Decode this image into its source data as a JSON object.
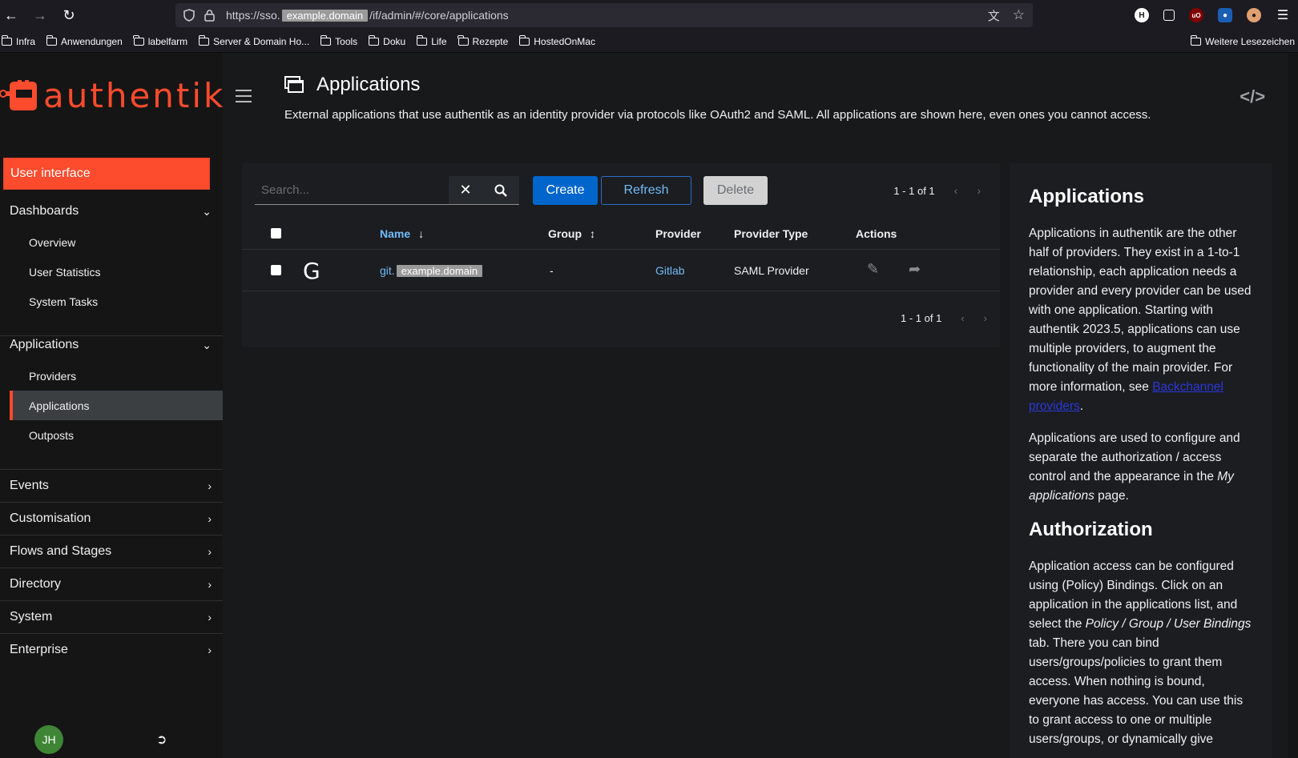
{
  "browser": {
    "url_prefix": "https://sso.",
    "url_redacted": "example.domain",
    "url_suffix": "/if/admin/#/core/applications",
    "bookmarks": [
      "Infra",
      "Anwendungen",
      "labelfarm",
      "Server & Domain Ho...",
      "Tools",
      "Doku",
      "Life",
      "Rezepte",
      "HostedOnMac"
    ],
    "bookmarks_more": "Weitere Lesezeichen"
  },
  "brand": {
    "name": "authentik",
    "color": "#fd4b2d"
  },
  "sidebar": {
    "user_interface": "User interface",
    "dashboards": {
      "label": "Dashboards",
      "items": [
        "Overview",
        "User Statistics",
        "System Tasks"
      ]
    },
    "applications": {
      "label": "Applications",
      "items": [
        "Providers",
        "Applications",
        "Outposts"
      ],
      "active": "Applications"
    },
    "collapsed": [
      "Events",
      "Customisation",
      "Flows and Stages",
      "Directory",
      "System",
      "Enterprise"
    ],
    "avatar": "JH"
  },
  "page": {
    "title": "Applications",
    "description": "External applications that use authentik as an identity provider via protocols like OAuth2 and SAML. All applications are shown here, even ones you cannot access."
  },
  "toolbar": {
    "search_placeholder": "Search...",
    "create": "Create",
    "refresh": "Refresh",
    "delete": "Delete",
    "pagination": "1 - 1 of 1"
  },
  "table": {
    "columns": {
      "name": "Name",
      "group": "Group",
      "provider": "Provider",
      "provider_type": "Provider Type",
      "actions": "Actions"
    },
    "rows": [
      {
        "icon_letter": "G",
        "name_prefix": "git.",
        "name_redacted": "example.domain",
        "group": "-",
        "provider": "Gitlab",
        "provider_type": "SAML Provider"
      }
    ]
  },
  "help": {
    "title": "Applications",
    "p1_a": "Applications in authentik are the other half of providers. They exist in a 1-to-1 relationship, each application needs a provider and every provider can be used with one application. Starting with authentik 2023.5, applications can use multiple providers, to augment the functionality of the main provider. For more information, see ",
    "p1_link": "Backchannel providers",
    "p1_b": ".",
    "p2_a": "Applications are used to configure and separate the authorization / access control and the appearance in the ",
    "p2_em": "My applications",
    "p2_b": " page.",
    "title2": "Authorization",
    "p3_a": "Application access can be configured using (Policy) Bindings. Click on an application in the applications list, and select the ",
    "p3_em": "Policy / Group / User Bindings",
    "p3_b": " tab. There you can bind users/groups/policies to grant them access. When nothing is bound, everyone has access. You can use this to grant access to one or multiple users/groups, or dynamically give"
  }
}
